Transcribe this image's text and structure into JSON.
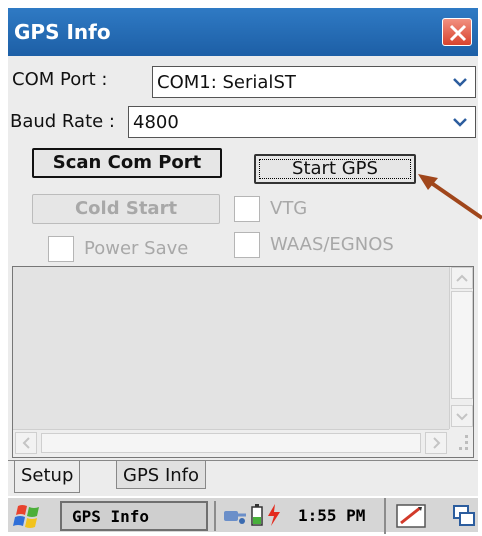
{
  "window": {
    "title": "GPS Info",
    "close_label": "×"
  },
  "form": {
    "com_port_label": "COM Port :",
    "com_port_value": "COM1:  SerialST",
    "baud_rate_label": "Baud Rate :",
    "baud_rate_value": "4800"
  },
  "buttons": {
    "scan": "Scan Com Port",
    "start": "Start GPS",
    "cold_start": "Cold Start"
  },
  "checkboxes": {
    "vtg": "VTG",
    "power_save": "Power Save",
    "waas": "WAAS/EGNOS"
  },
  "tabs": [
    "Setup",
    "GPS Info"
  ],
  "taskbar": {
    "task_label": "GPS Info",
    "clock": "1:55 PM"
  },
  "colors": {
    "titlebar": "#2f7ac4",
    "close": "#d8432e",
    "arrow": "#a0461b"
  }
}
